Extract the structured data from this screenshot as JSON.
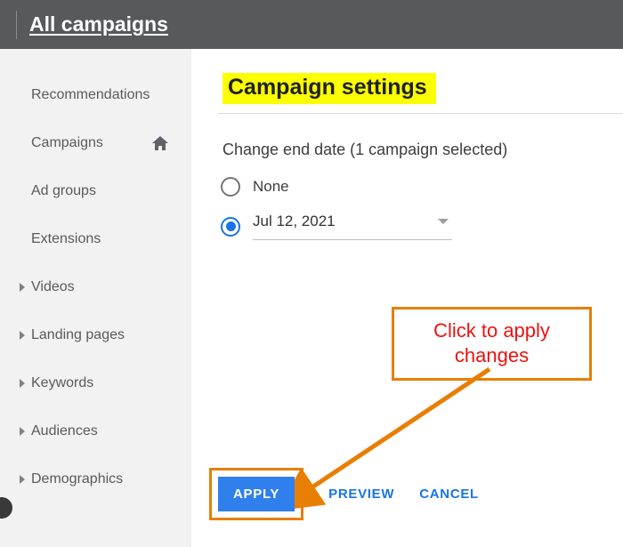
{
  "topbar": {
    "title": "All campaigns"
  },
  "sidebar": {
    "items": [
      {
        "label": "Recommendations",
        "caret": false,
        "home": false
      },
      {
        "label": "Campaigns",
        "caret": false,
        "home": true
      },
      {
        "label": "Ad groups",
        "caret": false,
        "home": false
      },
      {
        "label": "Extensions",
        "caret": false,
        "home": false
      },
      {
        "label": "Videos",
        "caret": true,
        "home": false
      },
      {
        "label": "Landing pages",
        "caret": true,
        "home": false
      },
      {
        "label": "Keywords",
        "caret": true,
        "home": false
      },
      {
        "label": "Audiences",
        "caret": true,
        "home": false
      },
      {
        "label": "Demographics",
        "caret": true,
        "home": false
      }
    ]
  },
  "page": {
    "heading": "Campaign settings",
    "subheading": "Change end date (1 campaign selected)",
    "radio": {
      "none_label": "None",
      "selected": "date"
    },
    "date_value": "Jul 12, 2021"
  },
  "buttons": {
    "apply": "APPLY",
    "preview": "PREVIEW",
    "cancel": "CANCEL"
  },
  "annotation": {
    "text": "Click to apply changes"
  }
}
